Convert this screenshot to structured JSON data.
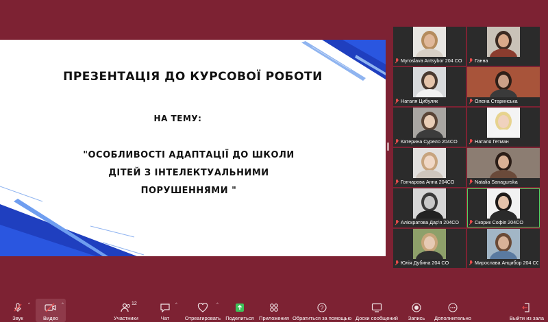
{
  "slide": {
    "title": "ПРЕЗЕНТАЦІЯ ДО КУРСОВОЇ РОБОТИ",
    "topic_label": "НА ТЕМУ:",
    "subject_lines": [
      "\"ОСОБЛИВОСТІ АДАПТАЦІЇ ДО ШКОЛИ",
      "ДІТЕЙ З ІНТЕЛЕКТУАЛЬНИМИ",
      "ПОРУШЕННЯМИ \""
    ]
  },
  "participants": [
    {
      "name": "Myroslava Antsybor 204 CO",
      "muted": true,
      "skin": "#e0b89a",
      "hair": "#b58c5e",
      "shirt": "#d8d0c6",
      "bg": "#e8e6e2"
    },
    {
      "name": "Ганна",
      "muted": true,
      "skin": "#d9a98a",
      "hair": "#3b2a22",
      "shirt": "#8a3c2e",
      "bg": "#c9c2b8"
    },
    {
      "name": "Наталя Цибуляк",
      "muted": true,
      "skin": "#e5c4aa",
      "hair": "#4a3a30",
      "shirt": "#f2f2f2",
      "bg": "#d8dadc"
    },
    {
      "name": "Олена Старинська",
      "muted": true,
      "skin": "#caa088",
      "hair": "#2e1f18",
      "shirt": "#3a3a3a",
      "bg": "#a8543a"
    },
    {
      "name": "Катерина Сурело 204CO",
      "muted": true,
      "skin": "#e9cdb6",
      "hair": "#5a4436",
      "shirt": "#3c3c3c",
      "bg": "#a9a6a2"
    },
    {
      "name": "Наталя Гетман",
      "muted": true,
      "skin": "#f0d2be",
      "hair": "#e7d38e",
      "shirt": "#f5f5f5",
      "bg": "#f4f4f4"
    },
    {
      "name": "Гончарова Анна 204CO",
      "muted": true,
      "skin": "#f0d8c6",
      "hair": "#c7a47e",
      "shirt": "#cfc6bd",
      "bg": "#e2e0de"
    },
    {
      "name": "Natalia Sanagurska",
      "muted": true,
      "skin": "#d9b095",
      "hair": "#2b1d17",
      "shirt": "#6a4a3a",
      "bg": "#8c7d72"
    },
    {
      "name": "Аліскратова Дар'я 204CO",
      "muted": true,
      "skin": "#c8c8c8",
      "hair": "#3a3a3a",
      "shirt": "#222222",
      "bg": "#d6d6d6"
    },
    {
      "name": "Скорик Софія 204CO",
      "muted": true,
      "skin": "#e4c2aa",
      "hair": "#1e1a18",
      "shirt": "#2a2a2a",
      "bg": "#f2f2f2"
    },
    {
      "name": "Юлія Дубина 204 CO",
      "muted": true,
      "skin": "#e6cab4",
      "hair": "#c8a57a",
      "shirt": "#2e2e2e",
      "bg": "#8ea06a"
    },
    {
      "name": "Мирослава Анцибор 204 CO",
      "muted": true,
      "skin": "#d8b298",
      "hair": "#6a4a36",
      "shirt": "#5a7aa0",
      "bg": "#a2b6c6"
    }
  ],
  "toolbar": {
    "audio": "Звук",
    "video": "Видео",
    "participants": "Участники",
    "participants_count": "12",
    "chat": "Чат",
    "react": "Отреагировать",
    "share": "Поделиться",
    "apps": "Приложения",
    "help": "Обратиться за помощью",
    "whiteboards": "Доски сообщений",
    "record": "Запись",
    "more": "Дополнительно",
    "leave": "Выйти из зала"
  },
  "colors": {
    "background": "#7d2233",
    "active_speaker": "#4fd264",
    "muted_icon": "#e74c4c",
    "slide_accent": "#1f3fbf"
  }
}
